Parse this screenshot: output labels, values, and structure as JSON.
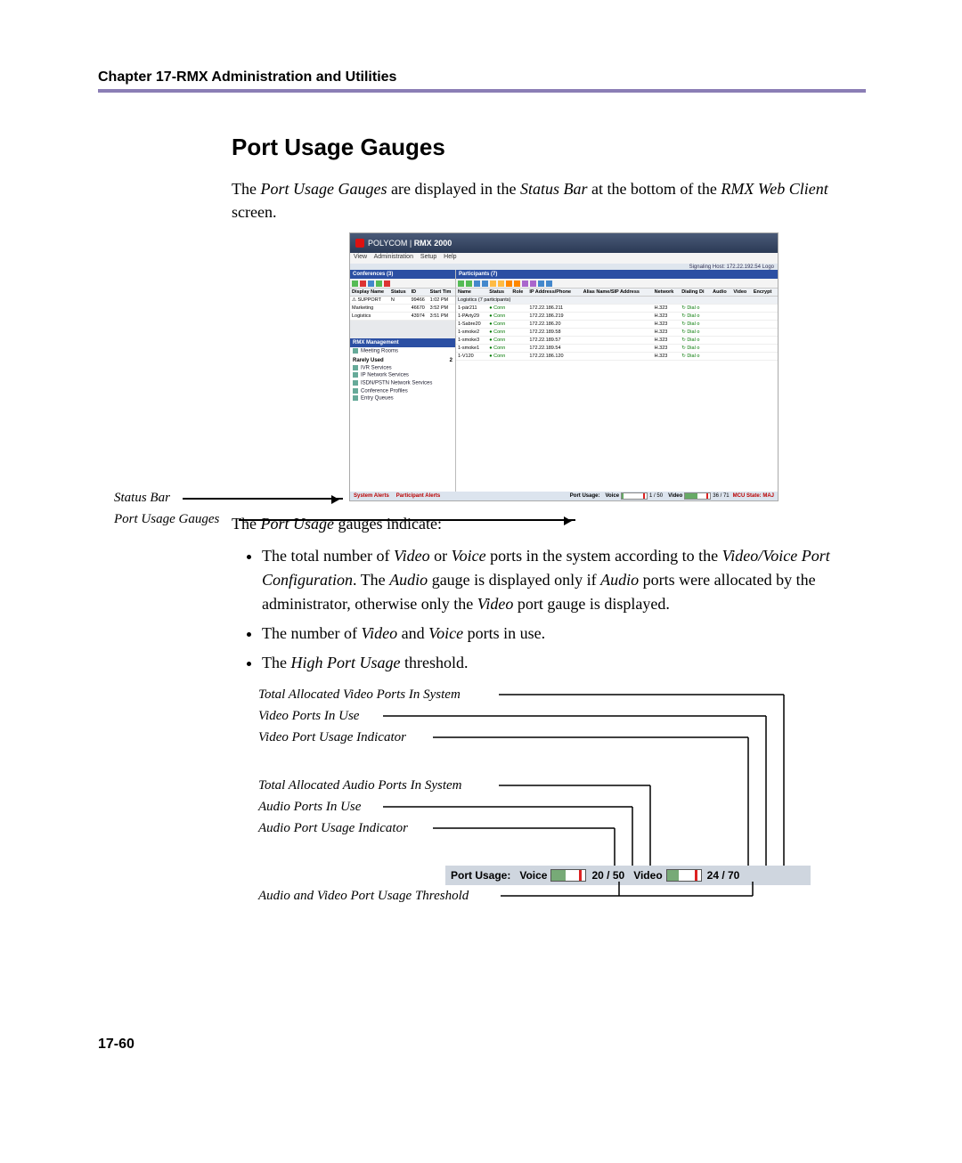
{
  "header": {
    "chapter": "Chapter 17-RMX Administration and Utilities"
  },
  "title": "Port Usage Gauges",
  "intro_html": "The <em>Port Usage Gauges</em> are displayed in the <em>Status Bar</em> at the bottom of the <em>RMX Web Client</em> screen.",
  "figure": {
    "app_title_prefix": "POLYCOM",
    "app_title": "RMX 2000",
    "menu": [
      "View",
      "Administration",
      "Setup",
      "Help"
    ],
    "signaling": "Signaling Host: 172.22.192.54    Logo",
    "left_header": "Conferences (3)",
    "conf_cols": [
      "Display Name",
      "Status",
      "ID",
      "Start Tim"
    ],
    "conf_rows": [
      {
        "name": "SUPPORT",
        "status": "N",
        "id": "99466",
        "time": "1:02 PM",
        "alert": true
      },
      {
        "name": "Marketing",
        "status": "",
        "id": "46670",
        "time": "3:52 PM"
      },
      {
        "name": "Logistics",
        "status": "",
        "id": "43974",
        "time": "3:51 PM"
      }
    ],
    "mgmt_header": "RMX Management",
    "mgmt_items_top": [
      "Meeting Rooms"
    ],
    "mgmt_rarely": "Rarely Used",
    "mgmt_rarely_count": "2",
    "mgmt_items": [
      "IVR Services",
      "IP Network Services",
      "ISDN/PSTN Network Services",
      "Conference Profiles",
      "Entry Queues"
    ],
    "right_header": "Participants (7)",
    "part_cols": [
      "Name",
      "Status",
      "Role",
      "IP Address/Phone",
      "Alias Name/SIP Address",
      "Network",
      "Dialing Di",
      "Audio",
      "Video",
      "Encrypt"
    ],
    "part_group": "Logistics (7 participants)",
    "part_rows": [
      {
        "name": "1-pär211",
        "status": "Conn",
        "ip": "172.22.186.211",
        "net": "H.323",
        "dir": "Dial o"
      },
      {
        "name": "1-PArty29",
        "status": "Conn",
        "ip": "172.22.186.219",
        "net": "H.323",
        "dir": "Dial o"
      },
      {
        "name": "1-Sabre20",
        "status": "Conn",
        "ip": "172.22.186.20",
        "net": "H.323",
        "dir": "Dial o"
      },
      {
        "name": "1-smoke2",
        "status": "Conn",
        "ip": "172.22.189.58",
        "net": "H.323",
        "dir": "Dial o"
      },
      {
        "name": "1-smoke3",
        "status": "Conn",
        "ip": "172.22.189.57",
        "net": "H.323",
        "dir": "Dial o"
      },
      {
        "name": "1-smoke1",
        "status": "Conn",
        "ip": "172.22.189.54",
        "net": "H.323",
        "dir": "Dial o"
      },
      {
        "name": "1-V120",
        "status": "Conn",
        "ip": "172.22.186.120",
        "net": "H.323",
        "dir": "Dial o"
      }
    ],
    "status": {
      "system_alerts": "System Alerts",
      "participant_alerts": "Participant Alerts",
      "port_usage_label": "Port Usage:",
      "voice_label": "Voice",
      "voice_value": "1 / 50",
      "video_label": "Video",
      "video_value": "36 / 71",
      "mcu": "MCU State: MAJ"
    }
  },
  "callouts": {
    "status_bar": "Status Bar",
    "port_usage": "Port Usage Gauges"
  },
  "para2": "The <em>Port Usage</em> gauges indicate:",
  "bullets": [
    "The total number of <em>Video</em> or <em>Voice</em> ports in the system according to the <em>Video/Voice Port Configuration</em>. The <em>Audio</em> gauge is displayed only if <em>Audio</em> ports were allocated by the administrator, otherwise only the <em>Video</em> port gauge is displayed.",
    "The number of <em>Video</em> and <em>Voice</em> ports in use.",
    "The <em>High Port Usage</em> threshold."
  ],
  "diagram": {
    "l1": "Total Allocated Video Ports In System",
    "l2": "Video Ports In Use",
    "l3": "Video Port Usage Indicator",
    "l4": "Total Allocated Audio Ports In System",
    "l5": "Audio Ports In Use",
    "l6": "Audio Port Usage Indicator",
    "l7": "Audio and Video Port Usage Threshold",
    "bar_label": "Port Usage:",
    "voice_label": "Voice",
    "voice_value": "20 / 50",
    "video_label": "Video",
    "video_value": "24 / 70"
  },
  "page_number": "17-60"
}
